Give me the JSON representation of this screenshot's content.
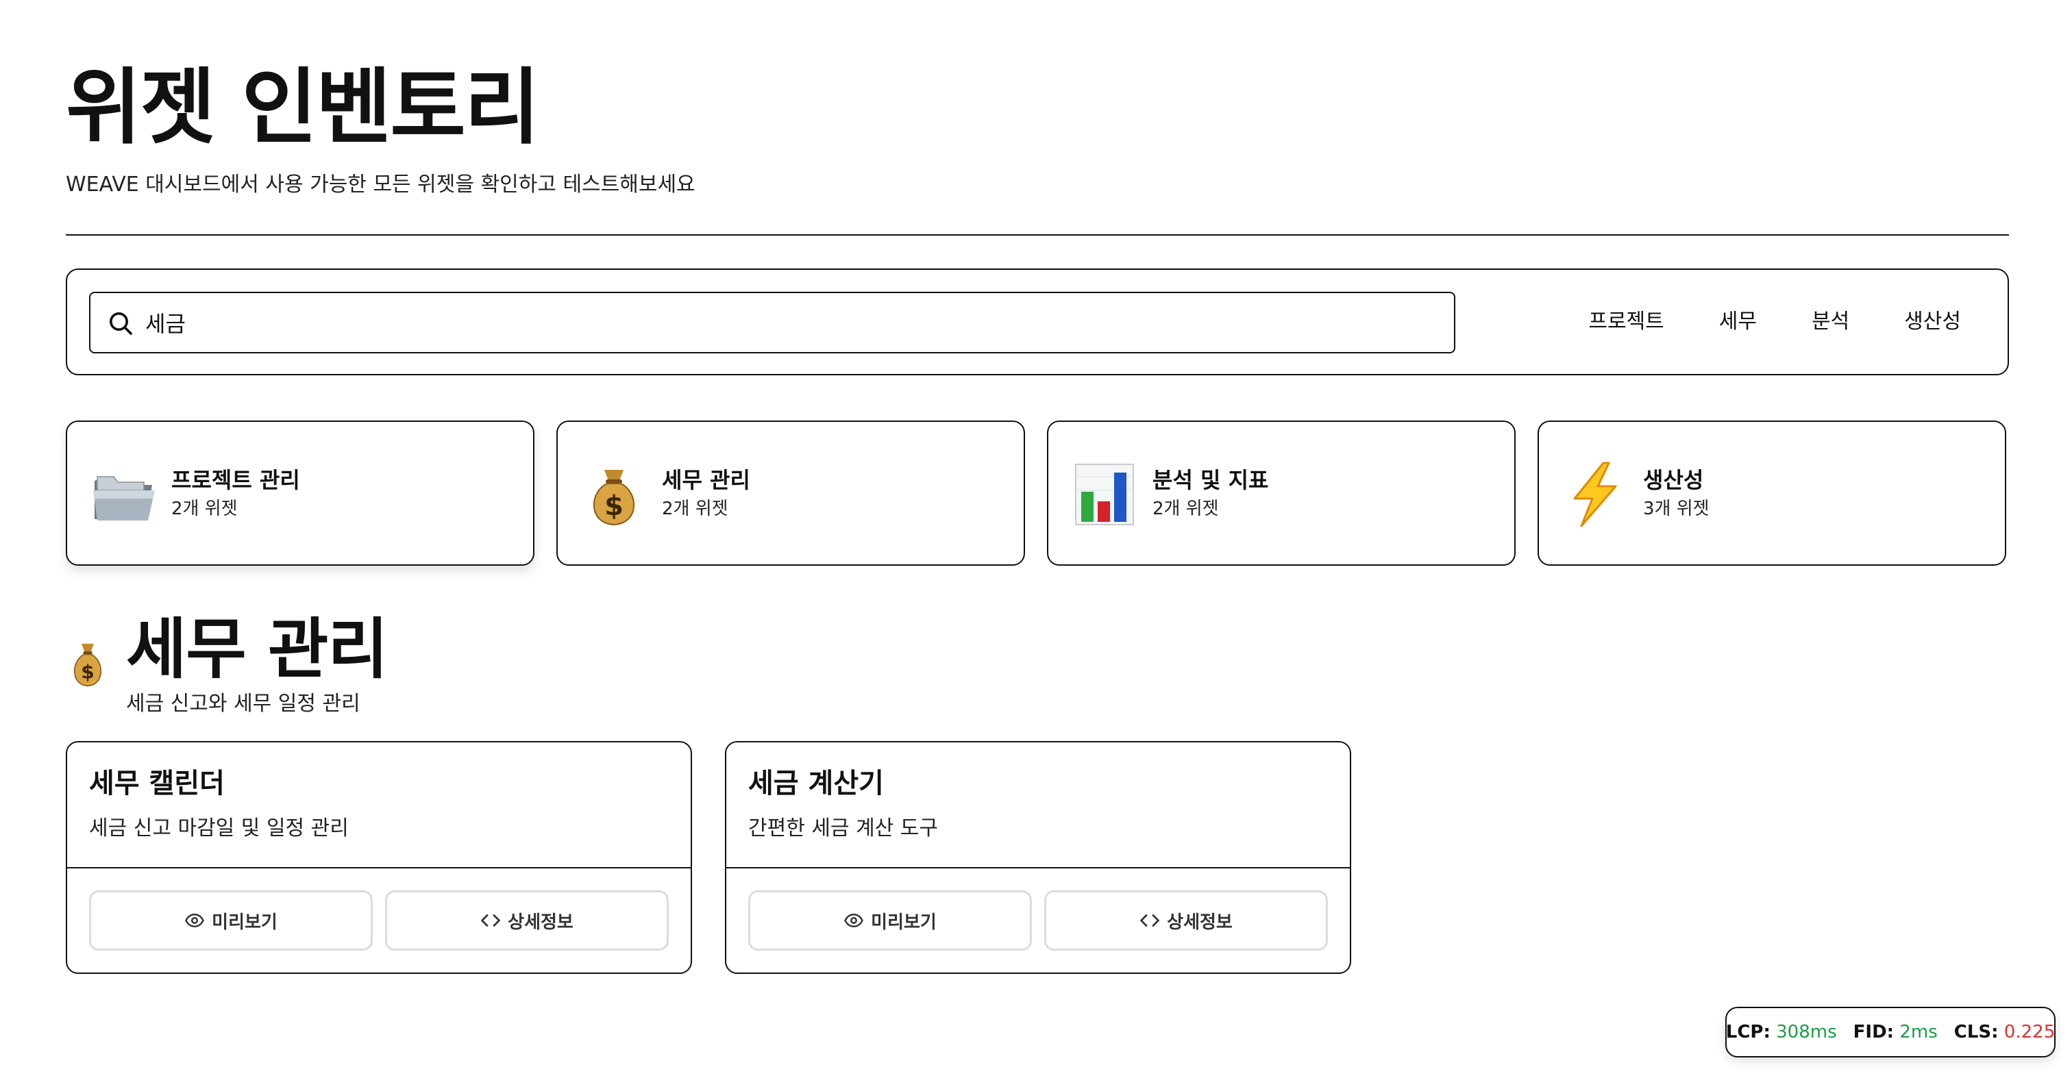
{
  "header": {
    "title": "위젯 인벤토리",
    "subtitle": "WEAVE 대시보드에서 사용 가능한 모든 위젯을 확인하고 테스트해보세요"
  },
  "search": {
    "value": "세금",
    "icon": "search-icon"
  },
  "filters": [
    {
      "label": "프로젝트"
    },
    {
      "label": "세무"
    },
    {
      "label": "분석"
    },
    {
      "label": "생산성"
    }
  ],
  "categories": [
    {
      "name": "프로젝트 관리",
      "count": "2개 위젯",
      "icon": "folder-icon"
    },
    {
      "name": "세무 관리",
      "count": "2개 위젯",
      "icon": "money-bag-icon"
    },
    {
      "name": "분석 및 지표",
      "count": "2개 위젯",
      "icon": "bar-chart-icon"
    },
    {
      "name": "생산성",
      "count": "3개 위젯",
      "icon": "lightning-icon"
    }
  ],
  "section": {
    "icon": "money-bag-icon",
    "title": "세무 관리",
    "subtitle": "세금 신고와 세무 일정 관리"
  },
  "widgets": [
    {
      "title": "세무 캘린더",
      "description": "세금 신고 마감일 및 일정 관리",
      "preview_label": "미리보기",
      "details_label": "상세정보"
    },
    {
      "title": "세금 계산기",
      "description": "간편한 세금 계산 도구",
      "preview_label": "미리보기",
      "details_label": "상세정보"
    }
  ],
  "performance": {
    "lcp_label": "LCP:",
    "lcp_value": "308ms",
    "fid_label": "FID:",
    "fid_value": "2ms",
    "cls_label": "CLS:",
    "cls_value": "0.225",
    "good_color": "#1a9e44",
    "bad_color": "#e03030"
  }
}
